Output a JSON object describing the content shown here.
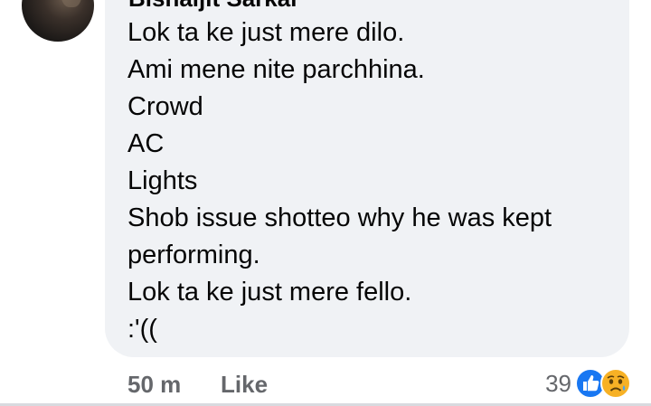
{
  "comment": {
    "author": "Bishaljit Sarkar",
    "lines": [
      "Lok ta ke just mere dilo.",
      "Ami mene nite parchhina.",
      "Crowd",
      "AC",
      "Lights",
      "Shob issue shotteo why he was kept",
      "performing.",
      "Lok ta ke just mere fello.",
      ":'(("
    ],
    "time": "50 m",
    "like_label": "Like",
    "reaction_count": "39",
    "reactions": [
      "like-icon",
      "sad-icon"
    ]
  },
  "colors": {
    "bubble": "#f0f2f5",
    "text": "#050505",
    "meta": "#65676b",
    "like_blue": "#1877f2",
    "sad_yellow": "#f7b125"
  }
}
